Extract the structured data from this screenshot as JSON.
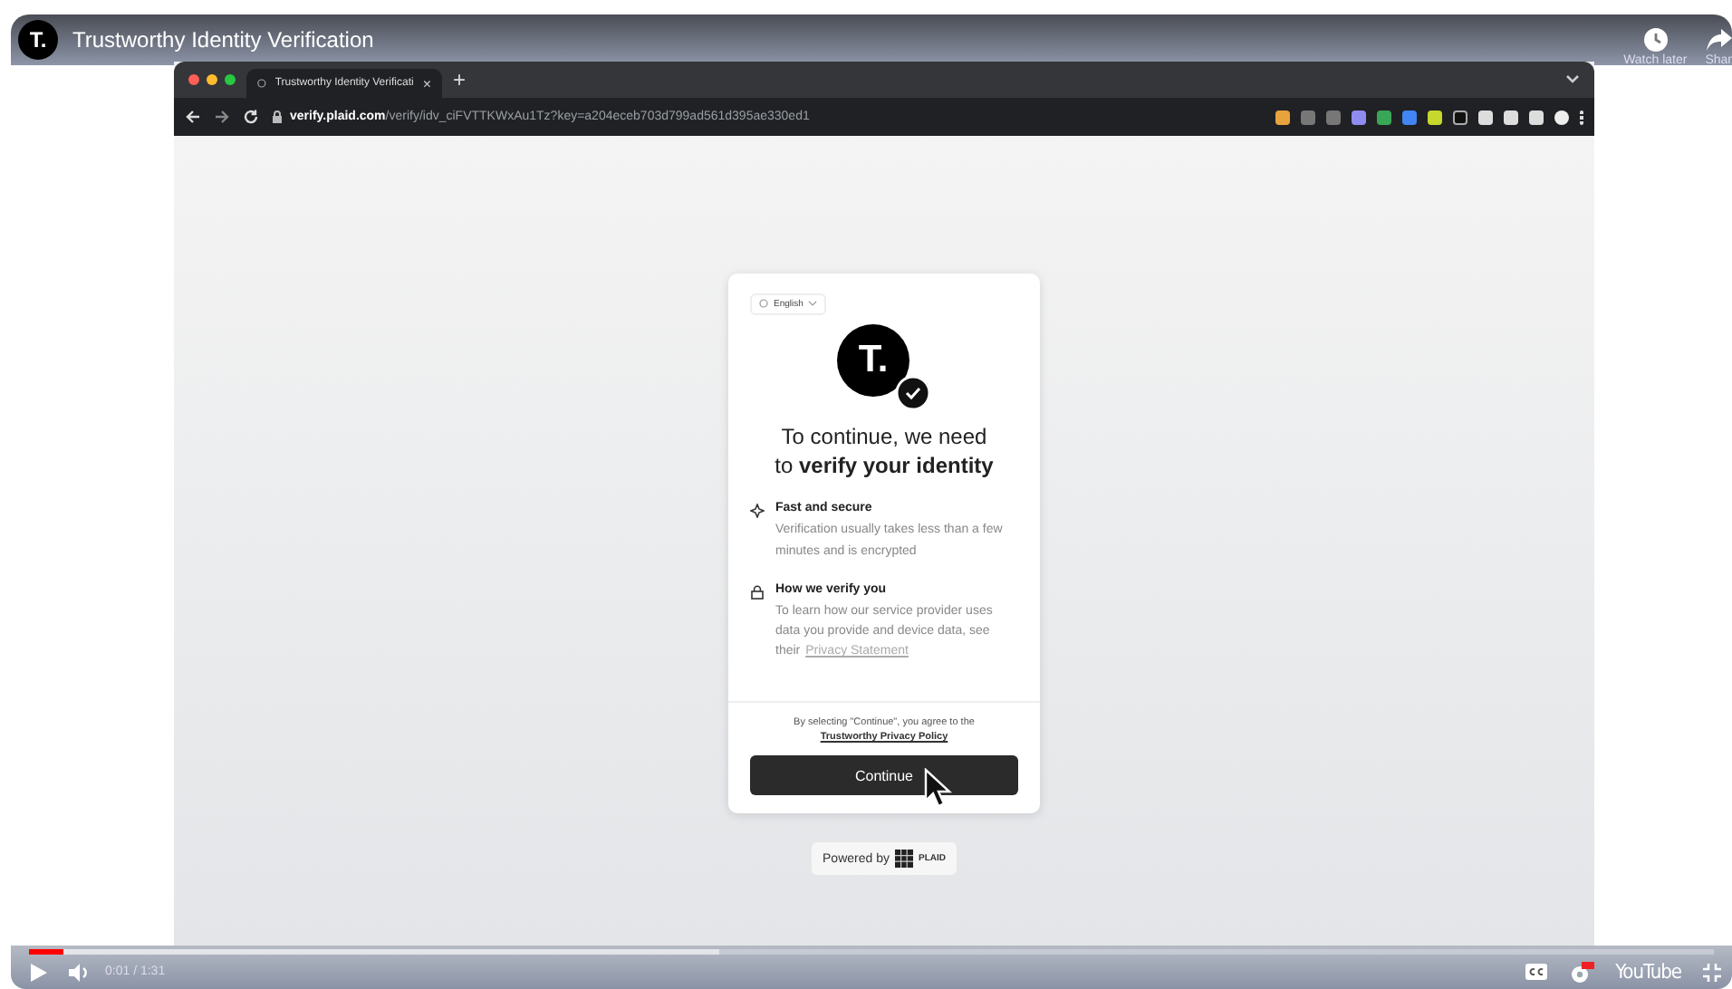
{
  "video": {
    "channel_logo": "T.",
    "title": "Trustworthy Identity Verification",
    "actions": [
      {
        "kind": "clock",
        "label": "Watch later"
      },
      {
        "kind": "share",
        "label": "Shar"
      }
    ]
  },
  "browser": {
    "tab": {
      "title": "Trustworthy Identity Verificati",
      "close": "×"
    },
    "new_tab": "+",
    "address": {
      "domain": "verify.plaid.com",
      "path": "/verify/idv_ciFVTTKWxAu1Tz?key=a204eceb703d799ad561d395ae330ed1"
    }
  },
  "card": {
    "language": "English",
    "logo": "T.",
    "heading": "To continue, we need\nto **verify your identity**",
    "features": [
      {
        "kind": "speed",
        "title": "Fast and secure",
        "text": "Verification usually takes less than a few minutes and is encrypted"
      },
      {
        "kind": "lock",
        "title": "How we verify you",
        "text": "To learn how our service provider uses data you provide and device data, see their",
        "link": "Privacy Statement"
      }
    ],
    "consent": "By selecting \"Continue\", you agree to the",
    "consent_link": "Trustworthy Privacy Policy",
    "button": "Continue"
  },
  "powered": {
    "text": "Powered by",
    "brand": "PLAID"
  },
  "player": {
    "level": 0.02,
    "time": "0:01 / 1:31",
    "brand": "YouTube"
  }
}
